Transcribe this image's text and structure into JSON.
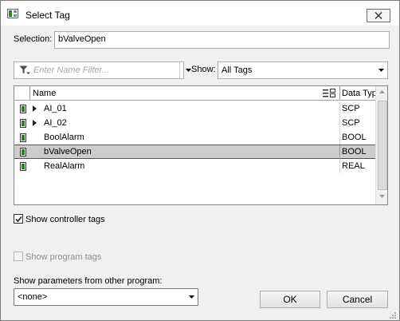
{
  "window": {
    "title": "Select Tag",
    "close_icon": "close-x-icon"
  },
  "selection": {
    "label": "Selection:",
    "value": "bValveOpen"
  },
  "filter": {
    "placeholder": "Enter Name Filter...",
    "icon": "funnel-filter-icon"
  },
  "show": {
    "label": "Show:",
    "value": "All Tags"
  },
  "grid": {
    "columns": {
      "name": "Name",
      "type": "Data Typ"
    },
    "rows": [
      {
        "name": "AI_01",
        "type": "SCP",
        "expandable": true,
        "selected": false
      },
      {
        "name": "AI_02",
        "type": "SCP",
        "expandable": true,
        "selected": false
      },
      {
        "name": "BoolAlarm",
        "type": "BOOL",
        "expandable": false,
        "selected": false
      },
      {
        "name": "bValveOpen",
        "type": "BOOL",
        "expandable": false,
        "selected": true
      },
      {
        "name": "RealAlarm",
        "type": "REAL",
        "expandable": false,
        "selected": false
      }
    ]
  },
  "options": {
    "controller_tags": {
      "label": "Show controller tags",
      "checked": true,
      "enabled": true
    },
    "program_tags": {
      "label": "Show program tags",
      "checked": false,
      "enabled": false
    }
  },
  "params": {
    "label": "Show parameters from other program:",
    "value": "<none>"
  },
  "buttons": {
    "ok": "OK",
    "cancel": "Cancel"
  },
  "colors": {
    "selected_row": "#cccccc",
    "dialog_bg": "#f0f0f0"
  }
}
